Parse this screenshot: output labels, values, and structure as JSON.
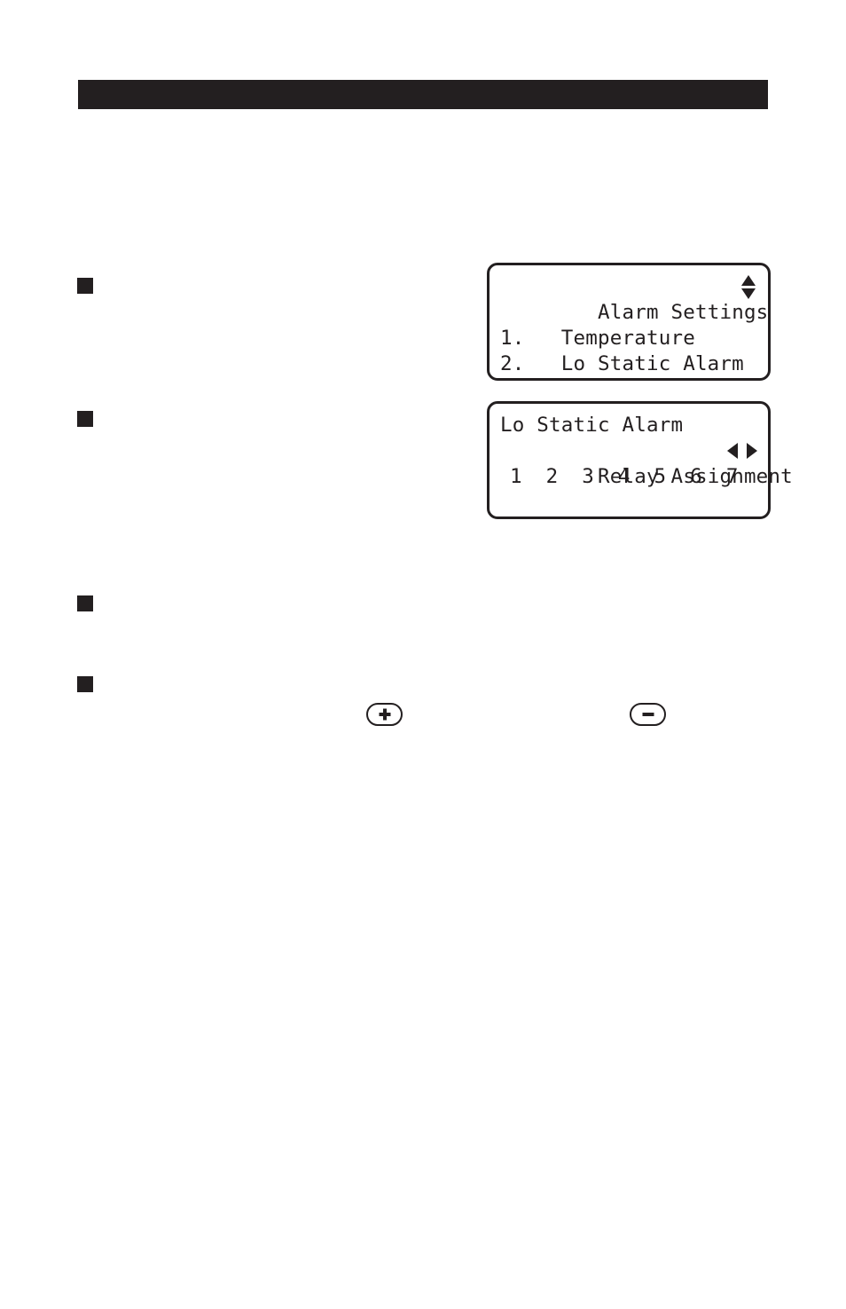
{
  "header": {
    "title": ""
  },
  "bullets": [
    {
      "marker": "filled-square",
      "text": ""
    },
    {
      "marker": "filled-square",
      "text": ""
    },
    {
      "marker": "filled-square",
      "text": ""
    },
    {
      "marker": "filled-square",
      "text": ""
    }
  ],
  "lcd_screens": [
    {
      "id": "alarm-settings-screen",
      "title": "Alarm Settings",
      "scroll_indicator": "up-down-arrows",
      "blank_line": "",
      "menu_items": [
        {
          "number": "1.",
          "label": "Temperature",
          "line": "1.   Temperature"
        },
        {
          "number": "2.",
          "label": "Lo Static Alarm",
          "line": "2.   Lo Static Alarm"
        }
      ]
    },
    {
      "id": "relay-assignment-screen",
      "line1": "Lo Static Alarm",
      "line2": "Relay Assignment",
      "scroll_indicator": "left-right-arrows",
      "relay_numbers": "1  2  3  4  5  6  7",
      "relays": [
        "1",
        "2",
        "3",
        "4",
        "5",
        "6",
        "7"
      ]
    }
  ],
  "keypad": {
    "plus": {
      "label": "+",
      "icon": "plus-icon"
    },
    "minus": {
      "label": "−",
      "icon": "minus-icon"
    }
  },
  "colors": {
    "ink": "#231f20",
    "paper": "#ffffff"
  }
}
